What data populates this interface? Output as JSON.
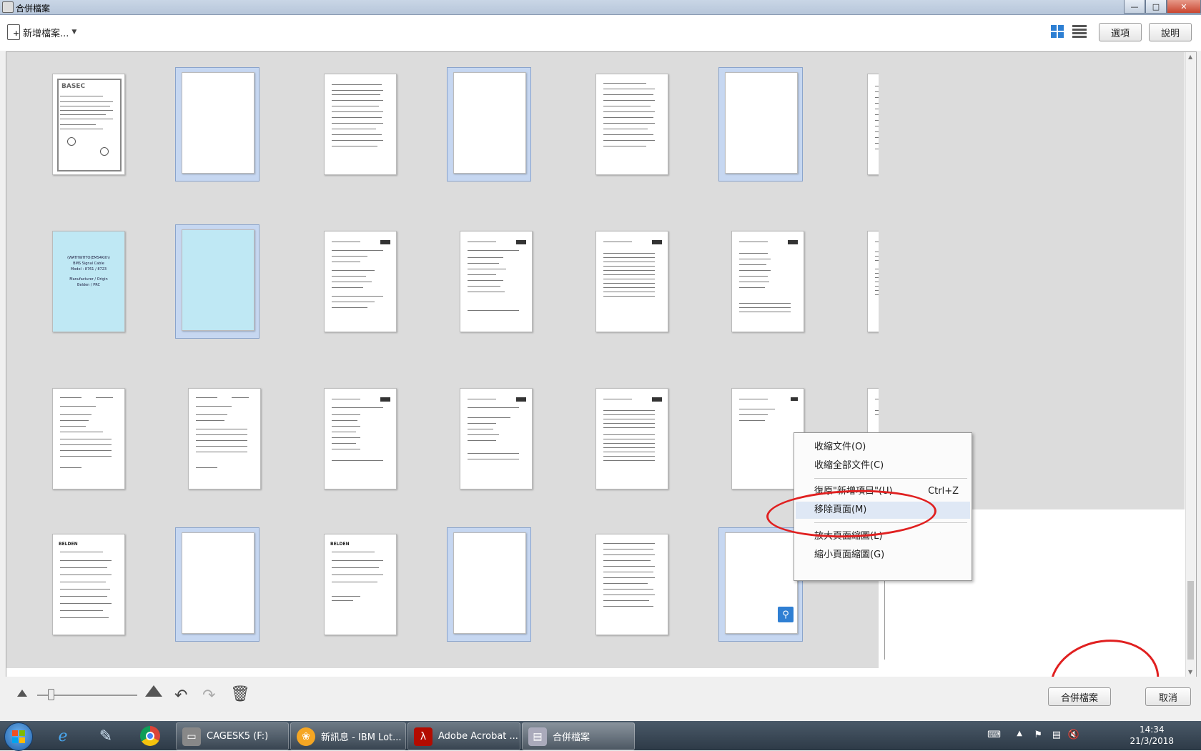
{
  "window": {
    "title": "合併檔案"
  },
  "toolbar": {
    "add_files_label": "新增檔案...",
    "options_label": "選項",
    "help_label": "說明"
  },
  "context_menu": {
    "items": [
      {
        "label": "收縮文件(O)"
      },
      {
        "label": "收縮全部文件(C)"
      },
      {
        "label": "復原\"新增項目\"(U)",
        "shortcut": "Ctrl+Z"
      },
      {
        "label": "移除頁面(M)"
      },
      {
        "label": "放大頁面縮圖(L)"
      },
      {
        "label": "縮小頁面縮圖(G)"
      }
    ]
  },
  "thumbnails": {
    "page1_text": "BASEC",
    "cyan_lines": [
      "(WATHWHTO(EMS4Kith)",
      "BMS Signal Cable",
      "Model : 8761 / 8723",
      "Manufacturer / Origin",
      "Belden / PRC"
    ],
    "belden_label": "BELDEN"
  },
  "bottom": {
    "merge_label": "合併檔案",
    "cancel_label": "取消"
  },
  "taskbar": {
    "tasks": [
      {
        "label": "CAGESK5 (F:)"
      },
      {
        "label": "新訊息 - IBM Lot..."
      },
      {
        "label": "Adobe Acrobat ..."
      },
      {
        "label": "合併檔案"
      }
    ],
    "time": "14:34",
    "date": "21/3/2018"
  },
  "colors": {
    "selection": "#c6d7f1",
    "accent": "#2d7fd3",
    "annotation": "#e02020"
  }
}
